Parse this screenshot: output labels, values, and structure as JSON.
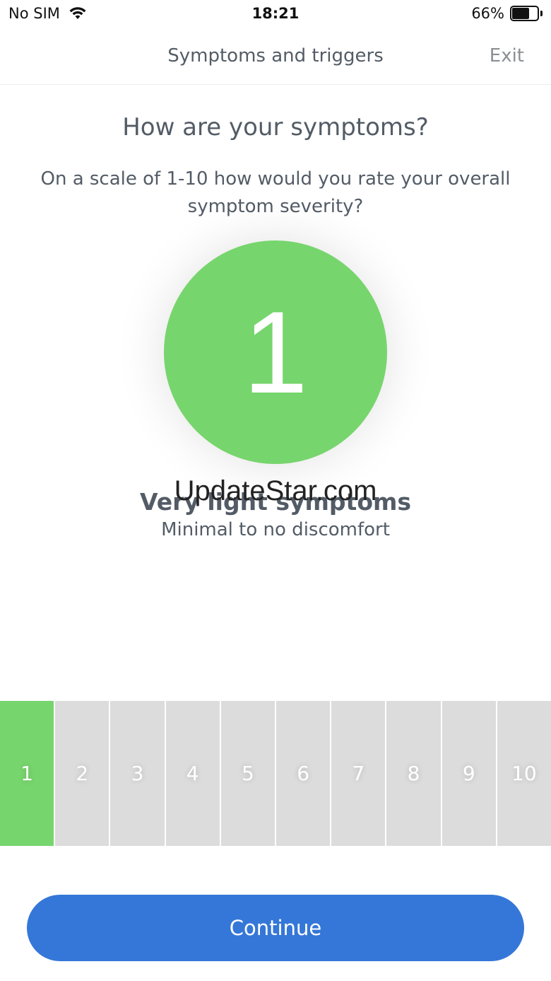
{
  "status_bar": {
    "carrier": "No SIM",
    "time": "18:21",
    "battery": "66%"
  },
  "nav": {
    "title": "Symptoms and triggers",
    "exit_label": "Exit"
  },
  "question": {
    "title": "How are your symptoms?",
    "description": "On a scale of 1-10 how would you rate your overall symptom severity?"
  },
  "score": {
    "value": "1",
    "color": "#77d56d"
  },
  "watermark": "UpdateStar.com",
  "level": {
    "title": "Very light symptoms",
    "description": "Minimal to no discomfort"
  },
  "scale": {
    "selected": 1,
    "options": [
      "1",
      "2",
      "3",
      "4",
      "5",
      "6",
      "7",
      "8",
      "9",
      "10"
    ]
  },
  "continue_label": "Continue",
  "colors": {
    "accent": "#3577d8",
    "selected": "#77d56d",
    "scale_background": "#dcdcdc"
  },
  "icons": [
    "wifi-icon",
    "battery-icon"
  ]
}
